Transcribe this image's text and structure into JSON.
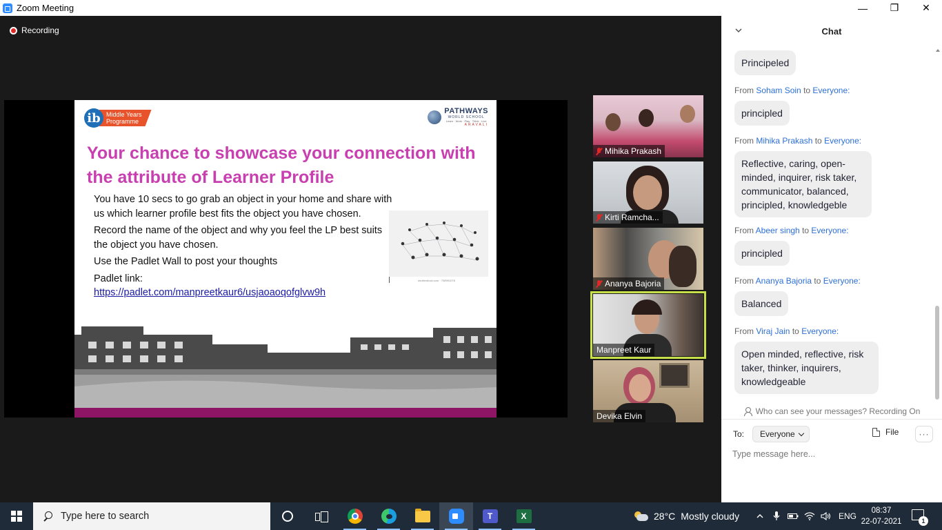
{
  "window": {
    "title": "Zoom Meeting",
    "minimize_glyph": "—",
    "restore_glyph": "❐",
    "close_glyph": "✕"
  },
  "meeting": {
    "recording_label": "Recording"
  },
  "slide": {
    "ib_logo_letter": "ib",
    "ib_logo_line1": "Middle Years",
    "ib_logo_line2": "Programme",
    "school_name": "PATHWAYS",
    "school_sub": "WORLD SCHOOL",
    "school_tagline": "Learn · Work · Play · Think · Live",
    "school_location": "ARAVALI",
    "title": "Your chance to showcase your connection with the attribute of Learner Profile",
    "para1": "You have 10 secs to go grab an object in your home and share with us which learner profile best fits the object you have chosen.",
    "para2": "Record the name of the object and why you feel the LP best suits the object you have chosen.",
    "para3": "Use the Padlet Wall  to post your thoughts",
    "padlet_label": "Padlet  link:",
    "padlet_url": "https://padlet.com/manpreetkaur6/usjaoaoqofglvw9h",
    "image_caption": "shutterstock.com · 708991078"
  },
  "participants": [
    {
      "name": "Mihika Prakash",
      "muted": true
    },
    {
      "name": "Kirti Ramcha...",
      "muted": true
    },
    {
      "name": "Ananya Bajoria",
      "muted": true
    },
    {
      "name": "Manpreet Kaur",
      "muted": false,
      "active": true
    },
    {
      "name": "Devika Elvin",
      "muted": false
    }
  ],
  "chat": {
    "title": "Chat",
    "from_word": "From",
    "to_word": "to",
    "first_message": "Principeled",
    "messages": [
      {
        "sender": "Soham Soin",
        "recipient": "Everyone:",
        "text": "principled"
      },
      {
        "sender": "Mihika Prakash",
        "recipient": "Everyone:",
        "text": "Reflective, caring, open-minded, inquirer, risk taker, communicator, balanced, principled, knowledgeble"
      },
      {
        "sender": "Abeer singh",
        "recipient": "Everyone:",
        "text": "principled"
      },
      {
        "sender": "Ananya Bajoria",
        "recipient": "Everyone:",
        "text": "Balanced"
      },
      {
        "sender": "Viraj Jain",
        "recipient": "Everyone:",
        "text": "Open minded, reflective, risk taker, thinker, inquirers, knowledgeable"
      }
    ],
    "notice": "Who can see your messages? Recording On",
    "to_label": "To:",
    "to_value": "Everyone",
    "file_label": "File",
    "more_label": "···",
    "input_placeholder": "Type message here..."
  },
  "taskbar": {
    "search_placeholder": "Type here to search",
    "weather_temp": "28°C",
    "weather_desc": "Mostly cloudy",
    "language": "ENG",
    "time": "08:37",
    "date": "22-07-2021",
    "notification_count": "1",
    "teams_letter": "T",
    "excel_letter": "X"
  }
}
